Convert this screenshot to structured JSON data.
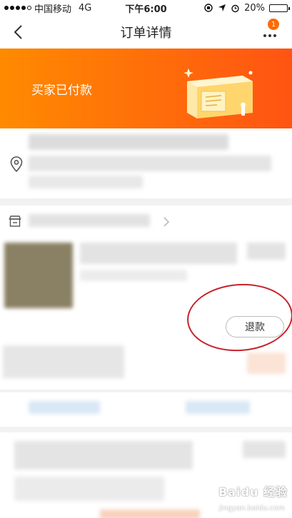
{
  "status_bar": {
    "carrier": "中国移动",
    "network": "4G",
    "time": "下午6:00",
    "battery": "20%",
    "battery_level": 0.2,
    "battery_color": "#e53935"
  },
  "nav": {
    "title": "订单详情",
    "badge_count": "1",
    "badge_color": "#ff6a00"
  },
  "banner": {
    "status_text": "买家已付款",
    "gradient_start": "#ff8a00",
    "gradient_end": "#ff5412"
  },
  "order_item": {
    "refund_label": "退款"
  },
  "watermark": {
    "text": "Baidu 经验",
    "sub": "jingyan.baidu.com"
  },
  "icons": [
    "back-icon",
    "more-icon",
    "location-icon",
    "shop-icon",
    "chevron-right-icon"
  ],
  "annotation_color": "#c8232c"
}
